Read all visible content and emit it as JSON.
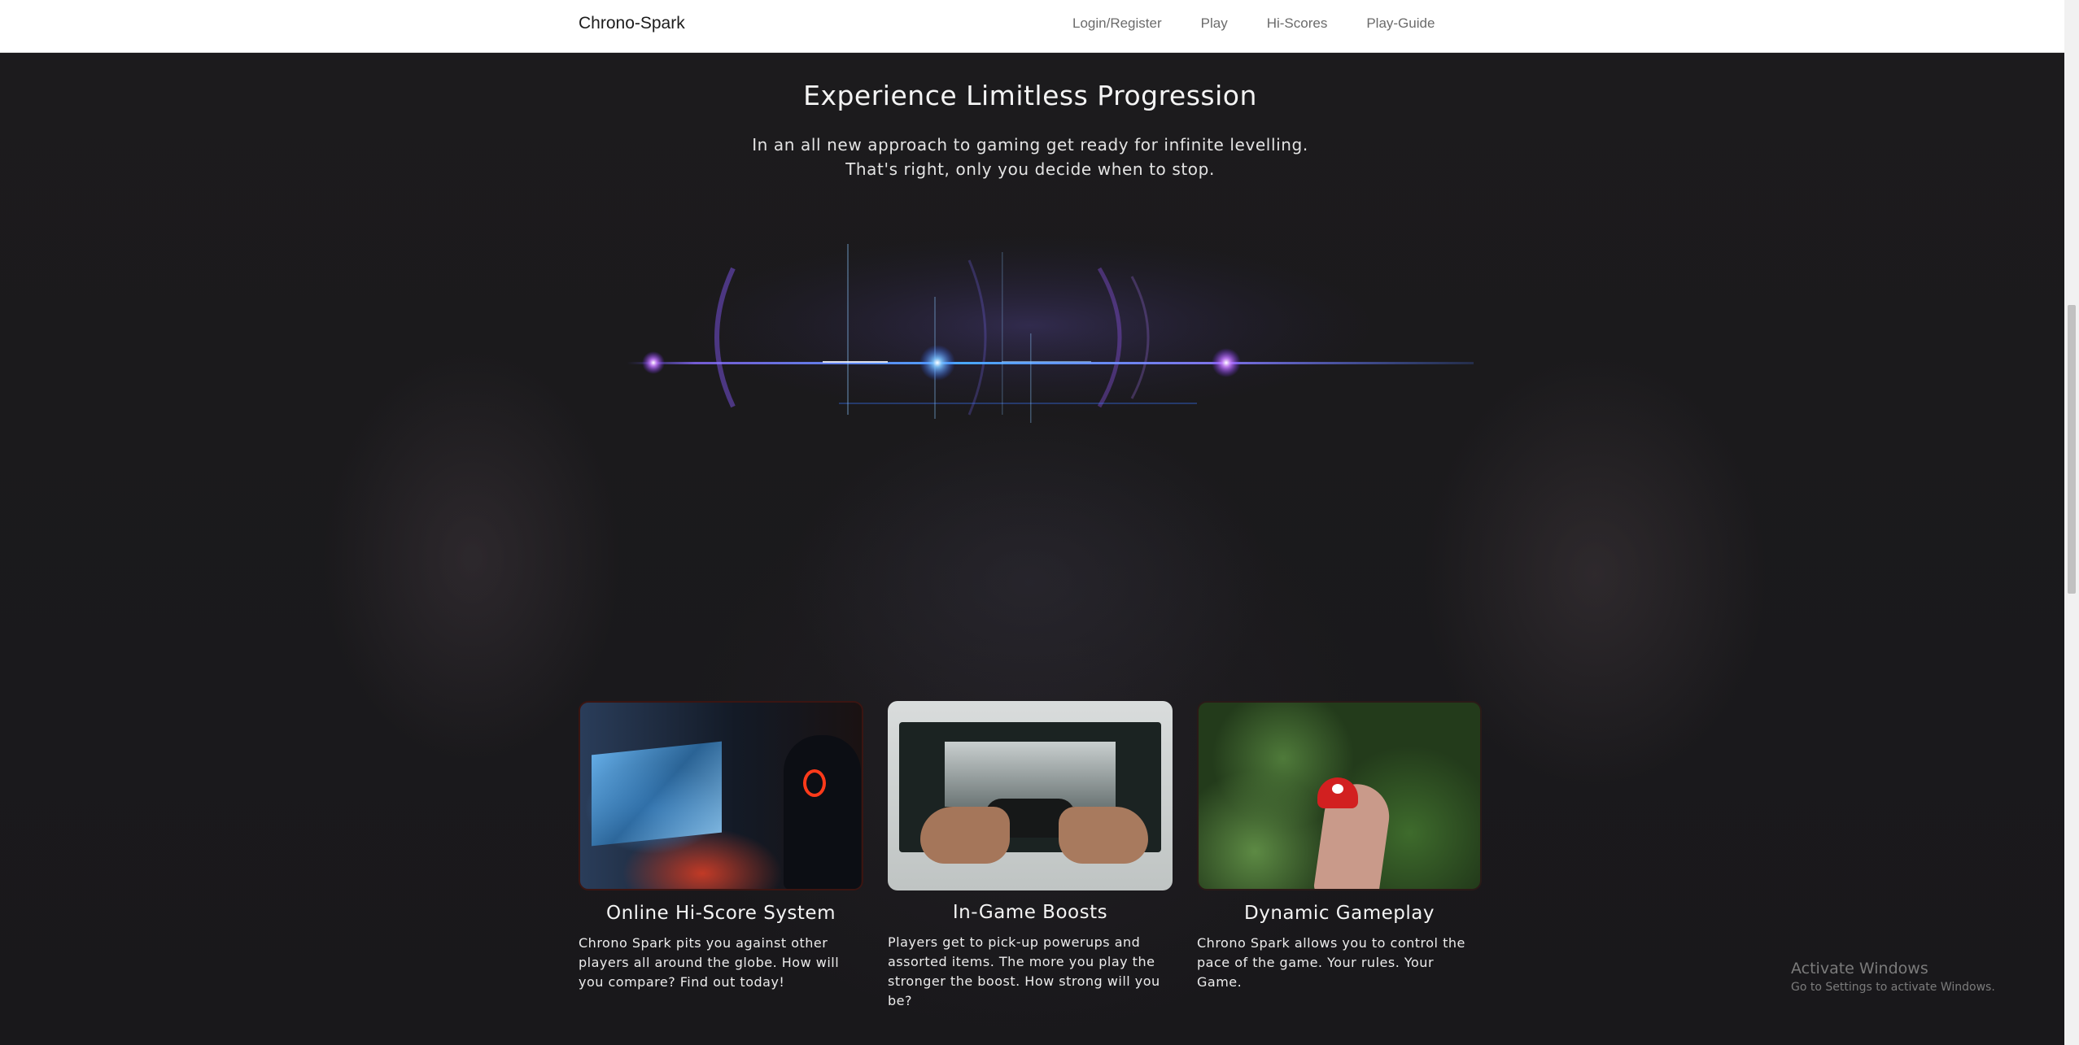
{
  "nav": {
    "brand": "Chrono-Spark",
    "links": [
      {
        "label": "Login/Register"
      },
      {
        "label": "Play"
      },
      {
        "label": "Hi-Scores"
      },
      {
        "label": "Play-Guide"
      }
    ]
  },
  "hero": {
    "title": "Experience Limitless Progression",
    "subtitle": "In an all new approach to gaming get ready for infinite levelling. That's right, only you decide when to stop."
  },
  "features": [
    {
      "image": "gamer-with-headset-photo",
      "title": "Online Hi-Score System",
      "text": "Chrono Spark pits you against other players all around the globe. How will you compare? Find out today!"
    },
    {
      "image": "hands-holding-controller-photo",
      "title": "In-Game Boosts",
      "text": "Players get to pick-up powerups and assorted items. The more you play the stronger the boost. How strong will you be?"
    },
    {
      "image": "hand-holding-mushroom-photo",
      "title": "Dynamic Gameplay",
      "text": "Chrono Spark allows you to control the pace of the game. Your rules. Your Game."
    }
  ],
  "system": {
    "activate_title": "Activate Windows",
    "activate_sub": "Go to Settings to activate Windows."
  },
  "colors": {
    "background": "#1b1a1c",
    "navbar": "#ffffff",
    "accent_blue": "#4aa8ff",
    "accent_purple": "#b45cff"
  }
}
